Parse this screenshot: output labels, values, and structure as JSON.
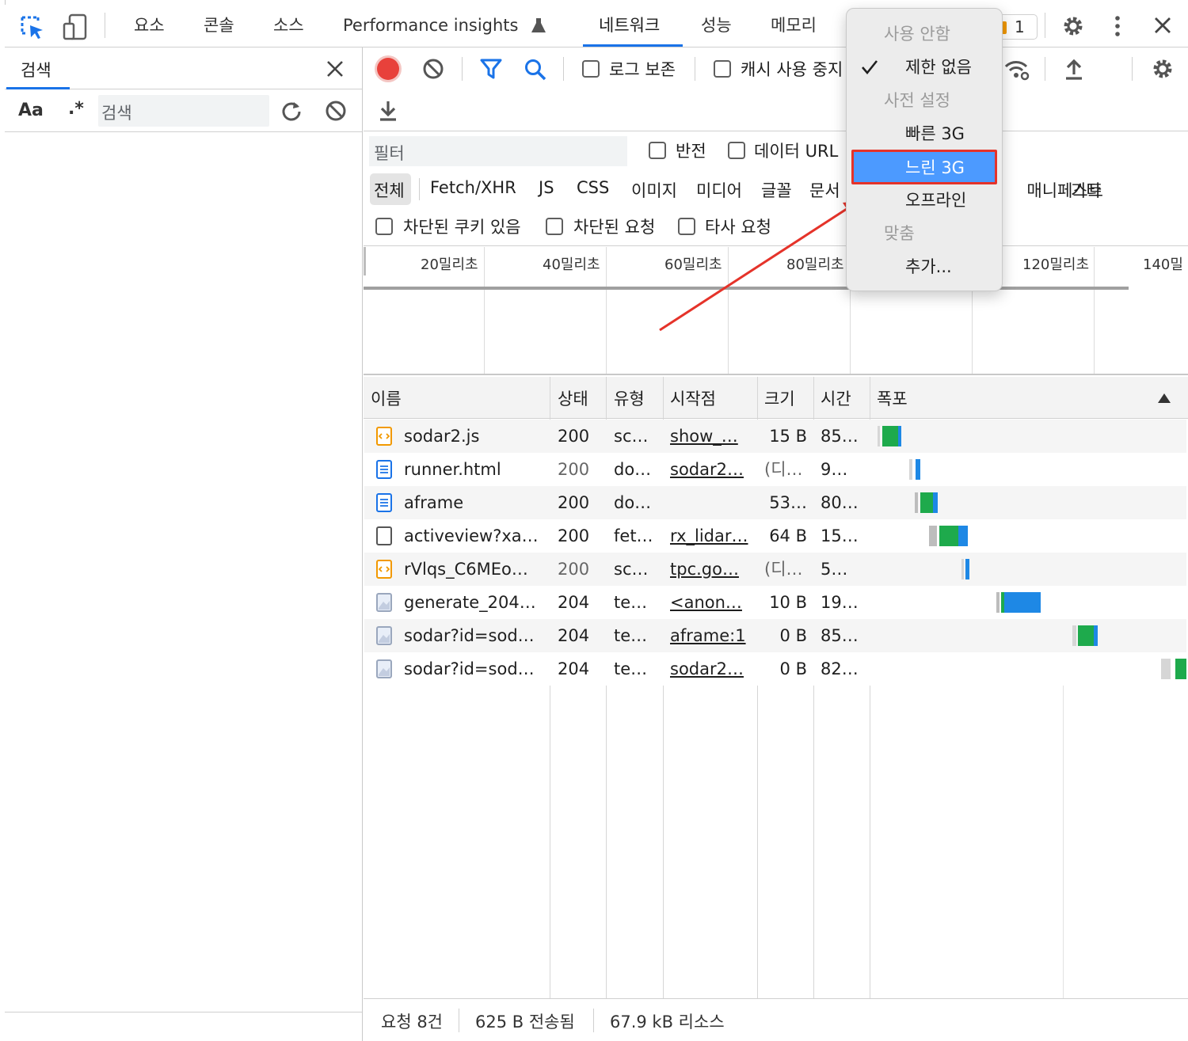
{
  "tabs": {
    "elements": "요소",
    "console": "콘솔",
    "sources": "소스",
    "perf_insights": "Performance insights",
    "network": "네트워크",
    "performance": "성능",
    "memory": "메모리",
    "issue_count": "1"
  },
  "search_panel": {
    "title": "검색",
    "match_case": "Aa",
    "regex": ".*",
    "placeholder": "검색"
  },
  "toolbar": {
    "preserve_log": "로그 보존",
    "disable_cache": "캐시 사용 중지"
  },
  "filter": {
    "placeholder": "필터",
    "invert": "반전",
    "hide_data_urls": "데이터 URL",
    "types": [
      "전체",
      "Fetch/XHR",
      "JS",
      "CSS",
      "이미지",
      "미디어",
      "글꼴",
      "문서"
    ],
    "types_right": [
      "매니페스트",
      "기타"
    ],
    "blocked_cookies": "차단된 쿠키 있음",
    "blocked_requests": "차단된 요청",
    "third_party": "타사 요청"
  },
  "timeline": {
    "ticks": [
      "20밀리초",
      "40밀리초",
      "60밀리초",
      "80밀리초",
      "120밀리초",
      "140밀"
    ]
  },
  "table": {
    "headers": {
      "name": "이름",
      "status": "상태",
      "type": "유형",
      "initiator": "시작점",
      "size": "크기",
      "time": "시간",
      "waterfall": "폭포"
    },
    "rows": [
      {
        "name": "sodar2.js",
        "status": "200",
        "type": "sc…",
        "initiator": "show_…",
        "size": "15 B",
        "time": "85…",
        "icon": "script-icon"
      },
      {
        "name": "runner.html",
        "status": "200",
        "type": "do…",
        "initiator": "sodar2…",
        "size": "(디…",
        "time": "9…",
        "icon": "document-icon"
      },
      {
        "name": "aframe",
        "status": "200",
        "type": "do…",
        "initiator": "",
        "size": "53…",
        "time": "80…",
        "icon": "document-icon"
      },
      {
        "name": "activeview?xa…",
        "status": "200",
        "type": "fet…",
        "initiator": "rx_lidar…",
        "size": "64 B",
        "time": "15…",
        "icon": "fetch-icon"
      },
      {
        "name": "rVlqs_C6MEo…",
        "status": "200",
        "type": "sc…",
        "initiator": "tpc.go…",
        "size": "(디…",
        "time": "5…",
        "icon": "script-icon"
      },
      {
        "name": "generate_204…",
        "status": "204",
        "type": "te…",
        "initiator": "<anon…",
        "size": "10 B",
        "time": "19…",
        "icon": "text-icon"
      },
      {
        "name": "sodar?id=sod…",
        "status": "204",
        "type": "te…",
        "initiator": "aframe:1",
        "size": "0 B",
        "time": "85…",
        "icon": "text-icon"
      },
      {
        "name": "sodar?id=sod…",
        "status": "204",
        "type": "te…",
        "initiator": "sodar2…",
        "size": "0 B",
        "time": "82…",
        "icon": "text-icon"
      }
    ]
  },
  "status_bar": {
    "requests": "요청 8건",
    "transferred": "625 B 전송됨",
    "resources": "67.9 kB 리소스"
  },
  "throttle_menu": {
    "disabled": "사용 안함",
    "no_throttling": "제한 없음",
    "presets_header": "사전 설정",
    "fast_3g": "빠른 3G",
    "slow_3g": "느린 3G",
    "offline": "오프라인",
    "custom_header": "맞춤",
    "add": "추가..."
  },
  "colors": {
    "accent": "#1a73e8",
    "record": "#e8413b",
    "highlight": "#4c9aff",
    "annotation": "#e5332a",
    "waterfall_green": "#1eaa4c",
    "waterfall_blue": "#1e88e5"
  }
}
